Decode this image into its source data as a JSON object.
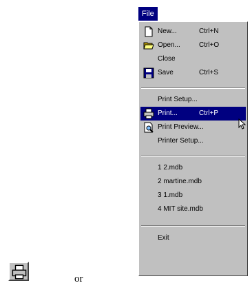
{
  "menu_title": "File",
  "menu_items": [
    {
      "label": "New...",
      "shortcut": "Ctrl+N",
      "icon": "new-document-icon"
    },
    {
      "label": "Open...",
      "shortcut": "Ctrl+O",
      "icon": "open-folder-icon"
    },
    {
      "label": "Close",
      "shortcut": ""
    },
    {
      "label": "Save",
      "shortcut": "Ctrl+S",
      "icon": "save-disk-icon"
    },
    {
      "label": "Print Setup...",
      "shortcut": ""
    },
    {
      "label": "Print...",
      "shortcut": "Ctrl+P",
      "icon": "printer-icon",
      "selected": true
    },
    {
      "label": "Print Preview...",
      "shortcut": "",
      "icon": "print-preview-icon"
    },
    {
      "label": "Printer Setup...",
      "shortcut": ""
    },
    {
      "label": "1 2.mdb",
      "shortcut": ""
    },
    {
      "label": "2 martine.mdb",
      "shortcut": ""
    },
    {
      "label": "3 1.mdb",
      "shortcut": ""
    },
    {
      "label": "4 MIT site.mdb",
      "shortcut": ""
    },
    {
      "label": "Exit",
      "shortcut": ""
    }
  ],
  "separator_text": "or",
  "toolbar": {
    "print_icon": "printer-icon"
  },
  "colors": {
    "menu_bg": "#c0c0c0",
    "highlight": "#000080",
    "highlight_text": "#ffffff"
  }
}
